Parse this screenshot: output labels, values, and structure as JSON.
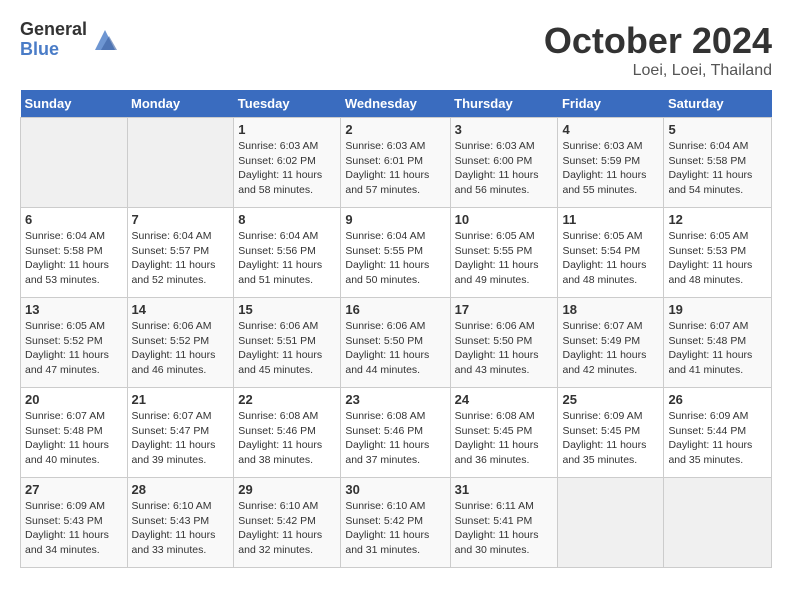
{
  "logo": {
    "general": "General",
    "blue": "Blue"
  },
  "title": "October 2024",
  "location": "Loei, Loei, Thailand",
  "weekdays": [
    "Sunday",
    "Monday",
    "Tuesday",
    "Wednesday",
    "Thursday",
    "Friday",
    "Saturday"
  ],
  "weeks": [
    [
      {
        "day": "",
        "info": ""
      },
      {
        "day": "",
        "info": ""
      },
      {
        "day": "1",
        "info": "Sunrise: 6:03 AM\nSunset: 6:02 PM\nDaylight: 11 hours and 58 minutes."
      },
      {
        "day": "2",
        "info": "Sunrise: 6:03 AM\nSunset: 6:01 PM\nDaylight: 11 hours and 57 minutes."
      },
      {
        "day": "3",
        "info": "Sunrise: 6:03 AM\nSunset: 6:00 PM\nDaylight: 11 hours and 56 minutes."
      },
      {
        "day": "4",
        "info": "Sunrise: 6:03 AM\nSunset: 5:59 PM\nDaylight: 11 hours and 55 minutes."
      },
      {
        "day": "5",
        "info": "Sunrise: 6:04 AM\nSunset: 5:58 PM\nDaylight: 11 hours and 54 minutes."
      }
    ],
    [
      {
        "day": "6",
        "info": "Sunrise: 6:04 AM\nSunset: 5:58 PM\nDaylight: 11 hours and 53 minutes."
      },
      {
        "day": "7",
        "info": "Sunrise: 6:04 AM\nSunset: 5:57 PM\nDaylight: 11 hours and 52 minutes."
      },
      {
        "day": "8",
        "info": "Sunrise: 6:04 AM\nSunset: 5:56 PM\nDaylight: 11 hours and 51 minutes."
      },
      {
        "day": "9",
        "info": "Sunrise: 6:04 AM\nSunset: 5:55 PM\nDaylight: 11 hours and 50 minutes."
      },
      {
        "day": "10",
        "info": "Sunrise: 6:05 AM\nSunset: 5:55 PM\nDaylight: 11 hours and 49 minutes."
      },
      {
        "day": "11",
        "info": "Sunrise: 6:05 AM\nSunset: 5:54 PM\nDaylight: 11 hours and 48 minutes."
      },
      {
        "day": "12",
        "info": "Sunrise: 6:05 AM\nSunset: 5:53 PM\nDaylight: 11 hours and 48 minutes."
      }
    ],
    [
      {
        "day": "13",
        "info": "Sunrise: 6:05 AM\nSunset: 5:52 PM\nDaylight: 11 hours and 47 minutes."
      },
      {
        "day": "14",
        "info": "Sunrise: 6:06 AM\nSunset: 5:52 PM\nDaylight: 11 hours and 46 minutes."
      },
      {
        "day": "15",
        "info": "Sunrise: 6:06 AM\nSunset: 5:51 PM\nDaylight: 11 hours and 45 minutes."
      },
      {
        "day": "16",
        "info": "Sunrise: 6:06 AM\nSunset: 5:50 PM\nDaylight: 11 hours and 44 minutes."
      },
      {
        "day": "17",
        "info": "Sunrise: 6:06 AM\nSunset: 5:50 PM\nDaylight: 11 hours and 43 minutes."
      },
      {
        "day": "18",
        "info": "Sunrise: 6:07 AM\nSunset: 5:49 PM\nDaylight: 11 hours and 42 minutes."
      },
      {
        "day": "19",
        "info": "Sunrise: 6:07 AM\nSunset: 5:48 PM\nDaylight: 11 hours and 41 minutes."
      }
    ],
    [
      {
        "day": "20",
        "info": "Sunrise: 6:07 AM\nSunset: 5:48 PM\nDaylight: 11 hours and 40 minutes."
      },
      {
        "day": "21",
        "info": "Sunrise: 6:07 AM\nSunset: 5:47 PM\nDaylight: 11 hours and 39 minutes."
      },
      {
        "day": "22",
        "info": "Sunrise: 6:08 AM\nSunset: 5:46 PM\nDaylight: 11 hours and 38 minutes."
      },
      {
        "day": "23",
        "info": "Sunrise: 6:08 AM\nSunset: 5:46 PM\nDaylight: 11 hours and 37 minutes."
      },
      {
        "day": "24",
        "info": "Sunrise: 6:08 AM\nSunset: 5:45 PM\nDaylight: 11 hours and 36 minutes."
      },
      {
        "day": "25",
        "info": "Sunrise: 6:09 AM\nSunset: 5:45 PM\nDaylight: 11 hours and 35 minutes."
      },
      {
        "day": "26",
        "info": "Sunrise: 6:09 AM\nSunset: 5:44 PM\nDaylight: 11 hours and 35 minutes."
      }
    ],
    [
      {
        "day": "27",
        "info": "Sunrise: 6:09 AM\nSunset: 5:43 PM\nDaylight: 11 hours and 34 minutes."
      },
      {
        "day": "28",
        "info": "Sunrise: 6:10 AM\nSunset: 5:43 PM\nDaylight: 11 hours and 33 minutes."
      },
      {
        "day": "29",
        "info": "Sunrise: 6:10 AM\nSunset: 5:42 PM\nDaylight: 11 hours and 32 minutes."
      },
      {
        "day": "30",
        "info": "Sunrise: 6:10 AM\nSunset: 5:42 PM\nDaylight: 11 hours and 31 minutes."
      },
      {
        "day": "31",
        "info": "Sunrise: 6:11 AM\nSunset: 5:41 PM\nDaylight: 11 hours and 30 minutes."
      },
      {
        "day": "",
        "info": ""
      },
      {
        "day": "",
        "info": ""
      }
    ]
  ]
}
